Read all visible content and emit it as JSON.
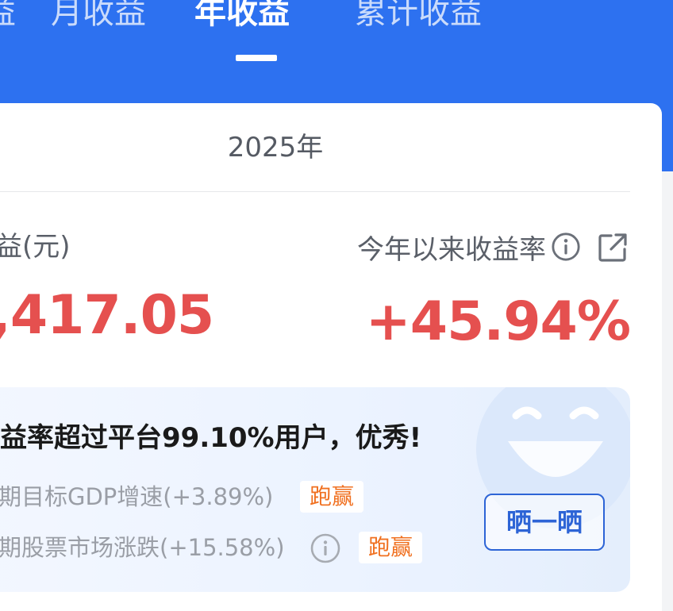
{
  "tabs": [
    {
      "label": "益",
      "active": false
    },
    {
      "label": "月收益",
      "active": false
    },
    {
      "label": "年收益",
      "active": true
    },
    {
      "label": "累计收益",
      "active": false
    }
  ],
  "summary": {
    "year": "2025年",
    "left_label": "益(元)",
    "left_value": ",417.05",
    "right_label": "今年以来收益率",
    "right_value": "+45.94%"
  },
  "banner": {
    "title": "益率超过平台99.10%用户，优秀!",
    "rows": [
      {
        "text": "期目标GDP增速(+3.89%)",
        "badge": "跑赢"
      },
      {
        "text": "期股票市场涨跌(+15.58%)",
        "badge": "跑赢"
      }
    ],
    "share_button": "晒一晒"
  },
  "colors": {
    "header_bg": "#2d71f0",
    "positive": "#e5504f",
    "badge_text": "#f07020",
    "button_blue": "#2d64d6"
  },
  "icons": {
    "info": "info-circle-icon",
    "share": "external-share-icon",
    "decoration": "smiley-face-icon"
  }
}
